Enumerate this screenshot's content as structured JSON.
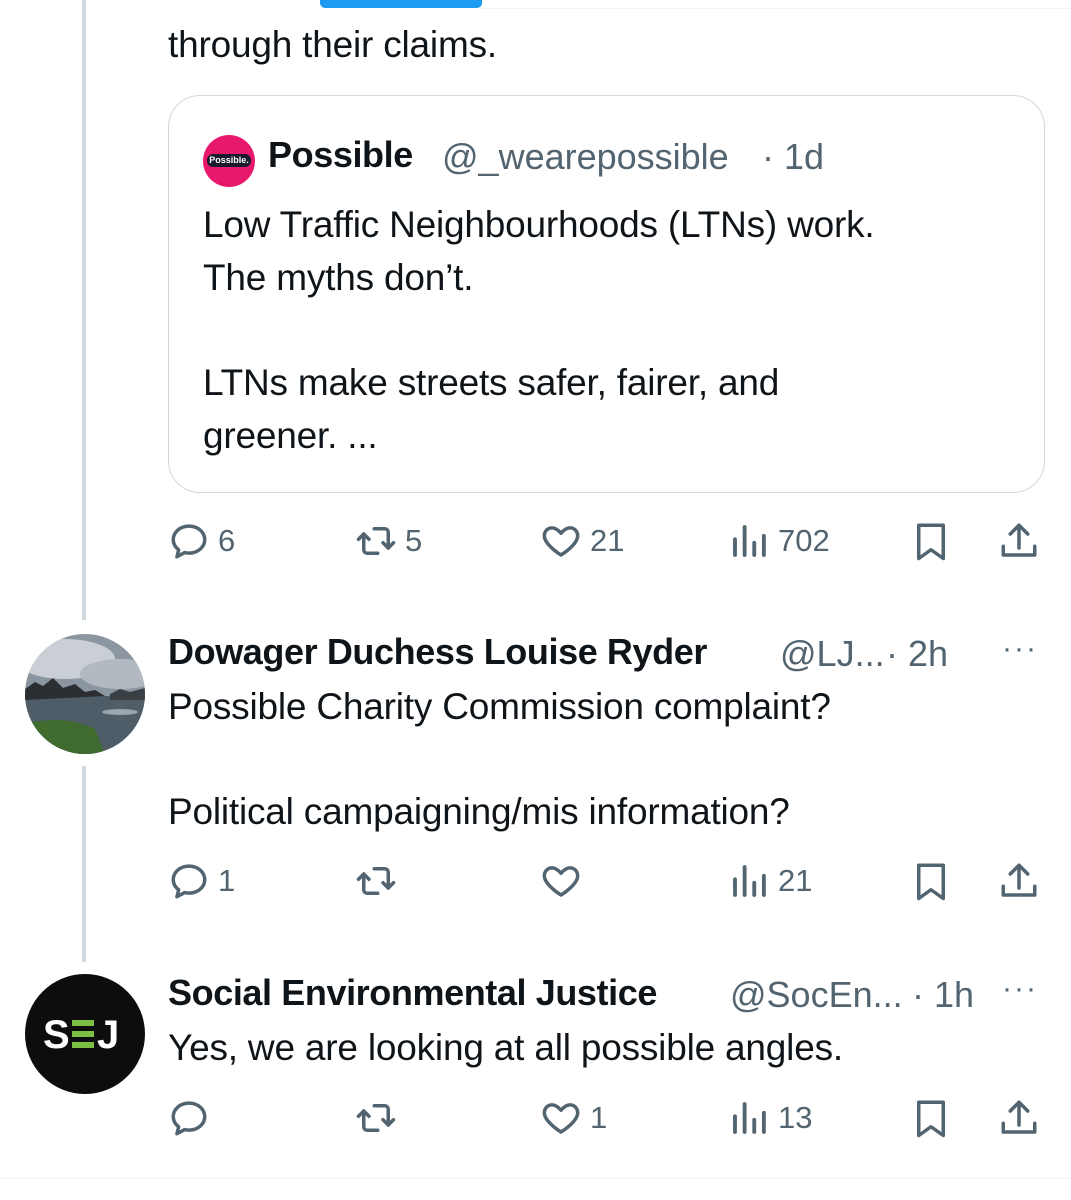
{
  "thread_top": {
    "text_tail": "through their claims."
  },
  "quoted_post": {
    "avatar_text": "Possible.",
    "name": "Possible",
    "handle": "@_wearepossible",
    "time": "· 1d",
    "line1": "Low Traffic Neighbourhoods (LTNs) work.",
    "line2": "The myths don’t.",
    "line3": "LTNs make streets safer, fairer, and",
    "line4": "greener. ..."
  },
  "post1_actions": {
    "replies": "6",
    "reposts": "5",
    "likes": "21",
    "views": "702"
  },
  "reply1": {
    "name": "Dowager Duchess Louise Ryder",
    "handle": "@LJ...",
    "time": "· 2h",
    "more": "···",
    "line1": "Possible Charity Commission complaint?",
    "line2": "Political campaigning/mis information?",
    "replies": "1",
    "reposts": "",
    "likes": "",
    "views": "21"
  },
  "reply2": {
    "avatar_text": "SEJ",
    "name": "Social Environmental Justice",
    "handle": "@SocEn...",
    "time": "· 1h",
    "more": "···",
    "line1": "Yes, we are looking at all possible angles.",
    "replies": "",
    "reposts": "",
    "likes": "1",
    "views": "13"
  },
  "colors": {
    "accent": "#1d9bf0",
    "muted": "#536471",
    "text": "#0f1419",
    "possible_brand": "#e8196d",
    "sej_green": "#7bc043"
  }
}
